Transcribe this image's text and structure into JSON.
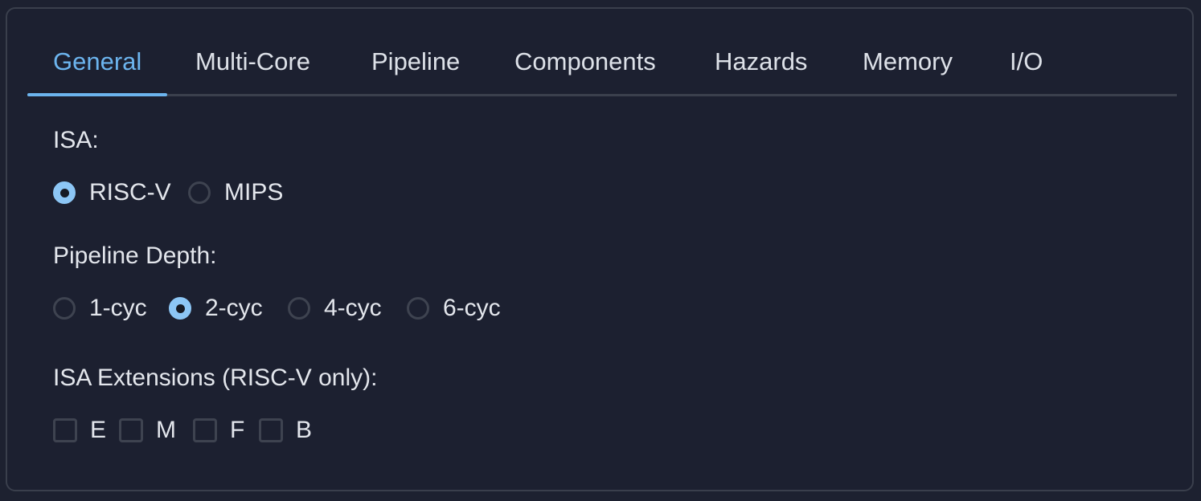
{
  "tabs": [
    {
      "label": "General",
      "active": true
    },
    {
      "label": "Multi-Core",
      "active": false
    },
    {
      "label": "Pipeline",
      "active": false
    },
    {
      "label": "Components",
      "active": false
    },
    {
      "label": "Hazards",
      "active": false
    },
    {
      "label": "Memory",
      "active": false
    },
    {
      "label": "I/O",
      "active": false
    }
  ],
  "isa": {
    "label": "ISA:",
    "options": [
      {
        "label": "RISC-V",
        "selected": true
      },
      {
        "label": "MIPS",
        "selected": false
      }
    ]
  },
  "pipeline_depth": {
    "label": "Pipeline Depth:",
    "options": [
      {
        "label": "1-cyc",
        "selected": false
      },
      {
        "label": "2-cyc",
        "selected": true
      },
      {
        "label": "4-cyc",
        "selected": false
      },
      {
        "label": "6-cyc",
        "selected": false
      }
    ]
  },
  "isa_extensions": {
    "label": "ISA Extensions (RISC-V only):",
    "options": [
      {
        "label": "E",
        "checked": false
      },
      {
        "label": "M",
        "checked": false
      },
      {
        "label": "F",
        "checked": false
      },
      {
        "label": "B",
        "checked": false
      }
    ]
  },
  "colors": {
    "background": "#1d2130",
    "accent": "#6cb4ee",
    "radio_checked": "#8cc6f5",
    "text": "#e3e6ec",
    "border": "#3a3f4c"
  }
}
